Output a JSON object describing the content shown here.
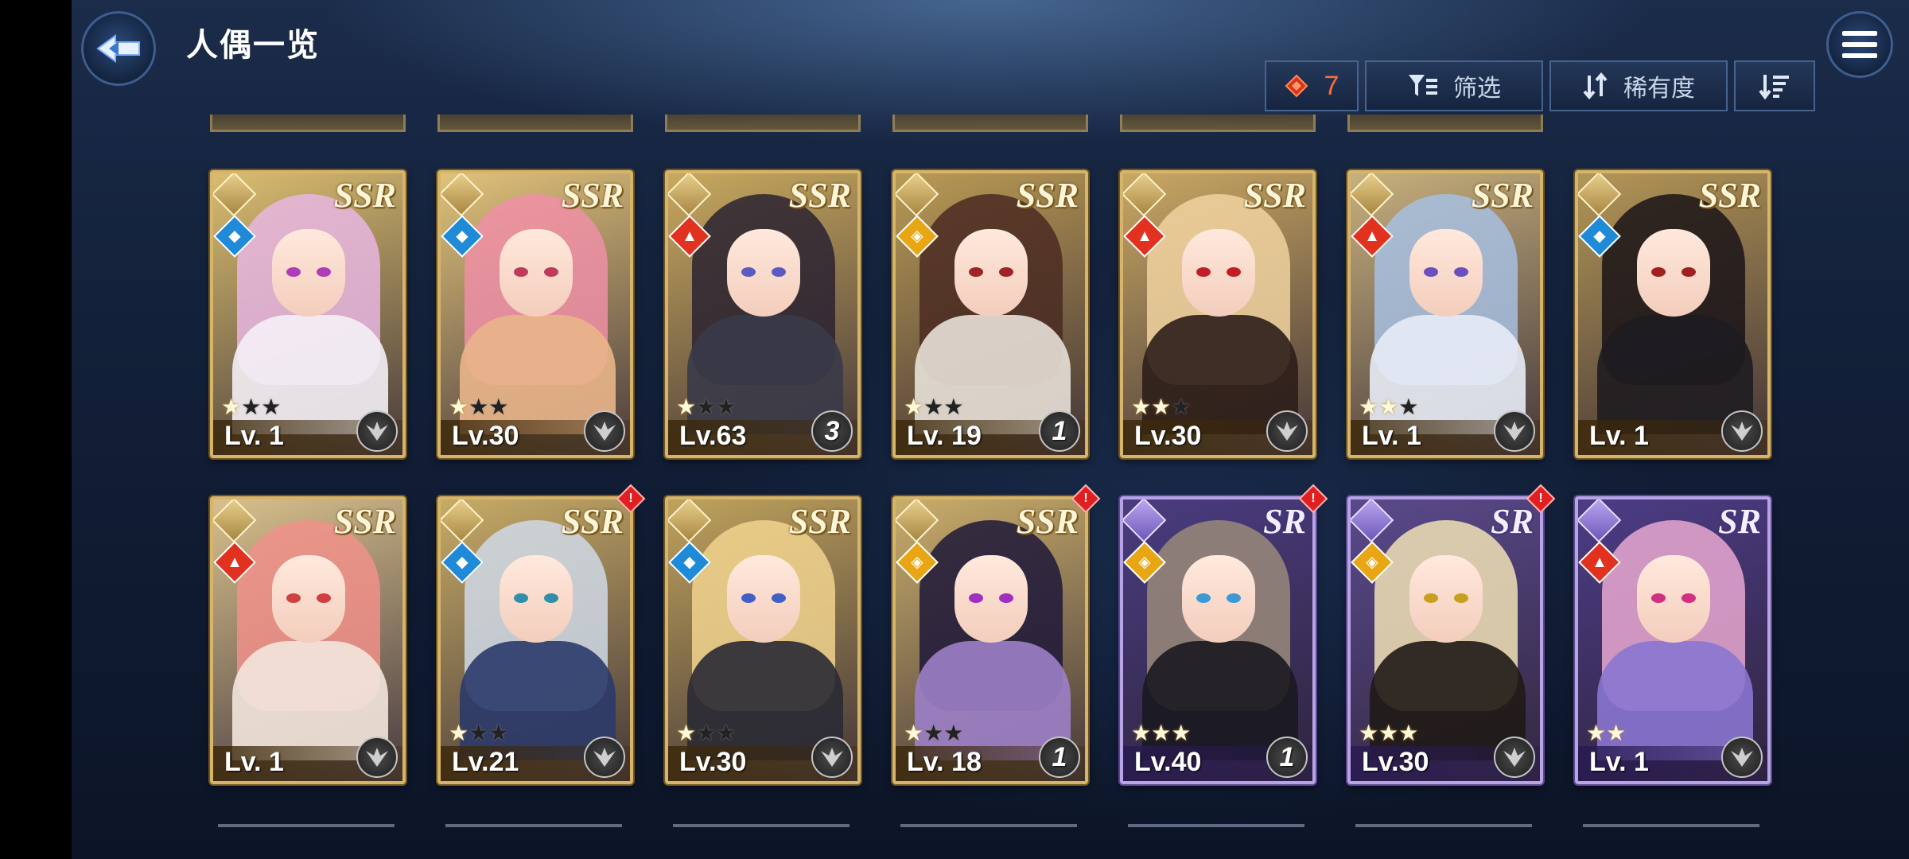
{
  "header": {
    "title": "人偶一览",
    "back_icon": "back-arrow-icon",
    "menu_icon": "hamburger-menu-icon"
  },
  "toolbar": {
    "count_value": "7",
    "filter_label": "筛选",
    "rarity_label": "稀有度",
    "colors": {
      "count": "#ff6a3a",
      "button_border": "#46648f"
    }
  },
  "cards": [
    {
      "rarity": "SSR",
      "level": "Lv. 1",
      "element": "water",
      "stars_on": 1,
      "stars_total": 3,
      "badge": "",
      "alert": false,
      "hair": "#e8b6e0",
      "body": "#f4f0f6",
      "eye": "#b03db8",
      "bg": "#d9bd6f"
    },
    {
      "rarity": "SSR",
      "level": "Lv.30",
      "element": "water",
      "stars_on": 1,
      "stars_total": 3,
      "badge": "",
      "alert": false,
      "hair": "#ee8fa6",
      "body": "#e9b58a",
      "eye": "#c0395a",
      "bg": "#e0c27a"
    },
    {
      "rarity": "SSR",
      "level": "Lv.63",
      "element": "fire",
      "stars_on": 1,
      "stars_total": 3,
      "badge": "3",
      "alert": false,
      "hair": "#2a2230",
      "body": "#3a3a48",
      "eye": "#5b5ac0",
      "bg": "#c8a95e"
    },
    {
      "rarity": "SSR",
      "level": "Lv. 19",
      "element": "light",
      "stars_on": 1,
      "stars_total": 3,
      "badge": "1",
      "alert": false,
      "hair": "#4a2a22",
      "body": "#e8e0d8",
      "eye": "#a0232a",
      "bg": "#b99a55"
    },
    {
      "rarity": "SSR",
      "level": "Lv.30",
      "element": "fire",
      "stars_on": 2,
      "stars_total": 3,
      "badge": "",
      "alert": false,
      "hair": "#f0d2a0",
      "body": "#2c1e1a",
      "eye": "#c21f24",
      "bg": "#c9a863"
    },
    {
      "rarity": "SSR",
      "level": "Lv. 1",
      "element": "fire",
      "stars_on": 2,
      "stars_total": 3,
      "badge": "",
      "alert": false,
      "hair": "#a7bfe0",
      "body": "#e8ecf6",
      "eye": "#6a4fbf",
      "bg": "#c7b07c"
    },
    {
      "rarity": "SSR",
      "level": "Lv. 1",
      "element": "water",
      "stars_on": 0,
      "stars_total": 0,
      "badge": "",
      "alert": false,
      "hair": "#1a1418",
      "body": "#1e1c20",
      "eye": "#a02020",
      "bg": "#b39656"
    },
    {
      "rarity": "SSR",
      "level": "Lv. 1",
      "element": "fire",
      "stars_on": 0,
      "stars_total": 0,
      "badge": "",
      "alert": false,
      "hair": "#f0908a",
      "body": "#f3e6dc",
      "eye": "#d04040",
      "bg": "#d8c08c"
    },
    {
      "rarity": "SSR",
      "level": "Lv.21",
      "element": "water",
      "stars_on": 1,
      "stars_total": 3,
      "badge": "",
      "alert": true,
      "hair": "#cfd9e6",
      "body": "#2b3a6a",
      "eye": "#2f8fa8",
      "bg": "#c7ab66"
    },
    {
      "rarity": "SSR",
      "level": "Lv.30",
      "element": "water",
      "stars_on": 1,
      "stars_total": 3,
      "badge": "",
      "alert": false,
      "hair": "#f1d48e",
      "body": "#2a2a34",
      "eye": "#4060c8",
      "bg": "#bfa25c"
    },
    {
      "rarity": "SSR",
      "level": "Lv. 18",
      "element": "light",
      "stars_on": 1,
      "stars_total": 3,
      "badge": "1",
      "alert": true,
      "hair": "#1d1838",
      "body": "#9c7fc8",
      "eye": "#a02ec0",
      "bg": "#c9ad6a"
    },
    {
      "rarity": "SR",
      "level": "Lv.40",
      "element": "light",
      "stars_on": 3,
      "stars_total": 3,
      "badge": "1",
      "alert": true,
      "hair": "#9a8a7a",
      "body": "#1a1820",
      "eye": "#3a9ad8",
      "bg": "#4a3c80"
    },
    {
      "rarity": "SR",
      "level": "Lv.30",
      "element": "light",
      "stars_on": 3,
      "stars_total": 3,
      "badge": "",
      "alert": true,
      "hair": "#f1e2b6",
      "body": "#201a16",
      "eye": "#c8a020",
      "bg": "#5a4a8c"
    },
    {
      "rarity": "SR",
      "level": "Lv. 1",
      "element": "fire",
      "stars_on": 2,
      "stars_total": 2,
      "badge": "",
      "alert": false,
      "hair": "#e8a8d0",
      "body": "#8a76d0",
      "eye": "#d03080",
      "bg": "#4c3c86"
    }
  ]
}
